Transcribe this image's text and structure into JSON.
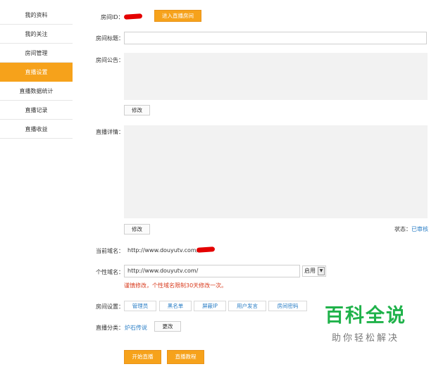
{
  "sidebar": {
    "items": [
      {
        "label": "我的资料"
      },
      {
        "label": "我的关注"
      },
      {
        "label": "房间管理"
      },
      {
        "label": "直播设置"
      },
      {
        "label": "直播数据统计"
      },
      {
        "label": "直播记录"
      },
      {
        "label": "直播收益"
      }
    ]
  },
  "room": {
    "id_label": "房间ID：",
    "enter_button": "进入直播房间",
    "title_label": "房间标题：",
    "title_value": "",
    "notice_label": "房间公告：",
    "notice_edit": "修改",
    "detail_label": "直播详情：",
    "detail_edit": "修改",
    "status_prefix": "状态：",
    "status_value": "已审核"
  },
  "domain": {
    "current_label": "当前域名：",
    "current_value": "http://www.douyutv.com/",
    "custom_label": "个性域名：",
    "custom_value": "http://www.douyutv.com/",
    "select_value": "启用",
    "warning": "谨慎修改，个性域名限制30天修改一次。"
  },
  "settings": {
    "label": "房间设置：",
    "buttons": [
      "管理员",
      "黑名单",
      "屏蔽IP",
      "用户发言",
      "房间密码"
    ]
  },
  "category": {
    "label": "直播分类：",
    "value": "炉石传说",
    "change_button": "更改"
  },
  "actions": {
    "start_live": "开始直播",
    "tutorial": "直播教程"
  },
  "watermark": {
    "title": "百科全说",
    "subtitle": "助你轻松解决"
  },
  "colors": {
    "accent": "#f6a21b",
    "link": "#2a7ec6",
    "warning": "#d83b1e",
    "watermark": "#1fb24a"
  }
}
